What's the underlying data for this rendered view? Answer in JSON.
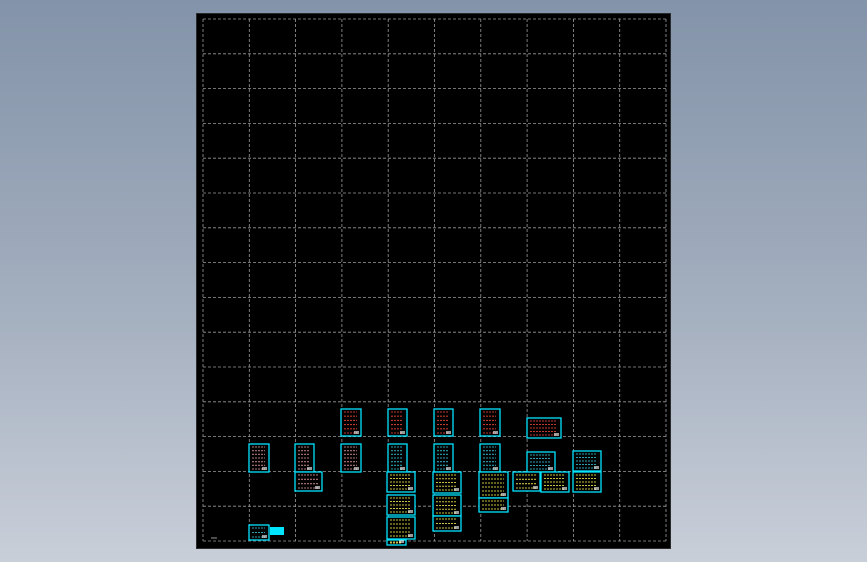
{
  "window": {
    "title": ""
  },
  "drawing": {
    "background": "#000000",
    "grid_color": "#9a9a9a",
    "frame_color": "#00e5ff",
    "grid_columns": 10,
    "grid_rows": 15,
    "sheet_count": 33,
    "icons": {
      "sheet": "drawing-sheet-icon",
      "tiny_mark": "minus-icon"
    }
  }
}
